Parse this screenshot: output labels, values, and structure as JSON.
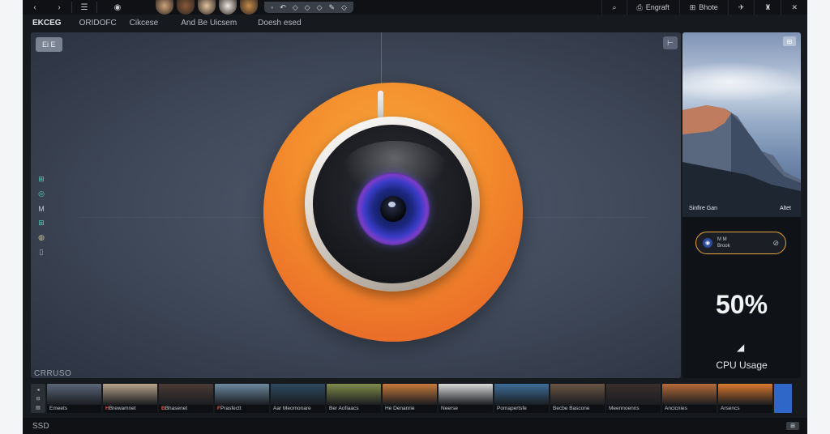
{
  "topbar": {
    "nav": {
      "back": "‹",
      "forward": "›",
      "menu": "☰",
      "record": "◉"
    },
    "tools": [
      "◦",
      "↶",
      "◇",
      "◇",
      "◇",
      "✎",
      "◇"
    ],
    "right": [
      {
        "icon": "⌕",
        "label": ""
      },
      {
        "icon": "⎙",
        "label": "Engraft"
      },
      {
        "icon": "⊞",
        "label": "Bhote"
      },
      {
        "icon": "✈",
        "label": ""
      },
      {
        "icon": "♜",
        "label": ""
      },
      {
        "icon": "✕",
        "label": ""
      }
    ],
    "avatar_colors": [
      "#cfa27a",
      "#8b5a3a",
      "#e3c2a0",
      "#efe7e0",
      "#c48a4a"
    ]
  },
  "menubar": [
    "EKCEG",
    "ORIDOFC",
    "Cikcese",
    "And Be Uicsem",
    "Doesh esed"
  ],
  "canvas": {
    "chip_label": "Ei E",
    "corner_icon": "⊢",
    "left_icons": [
      "⊞",
      "◎",
      "M",
      "⊞",
      "◍",
      "▯"
    ],
    "caption": "CRRUSO"
  },
  "right_panel": {
    "photo_btn": "⊞",
    "photo_caption": "Sinfire Gan",
    "photo_tag": "Altet",
    "pill": {
      "icon": "◉",
      "line1": "M M",
      "line2": "Brook",
      "end": "⊘"
    },
    "value": "50%",
    "arrow": "◢",
    "label": "CPU Usage"
  },
  "filmstrip": {
    "side_icons": [
      "◂",
      "⊟",
      "▤"
    ],
    "frames": [
      {
        "label": "Emeets",
        "accent": "",
        "color": "#5b6678"
      },
      {
        "label": "Brewamnet",
        "accent": "H",
        "color": "#b8a48c"
      },
      {
        "label": "Bhasenet",
        "accent": "B",
        "color": "#4a3a36"
      },
      {
        "label": "Prasfectt",
        "accent": "F",
        "color": "#6d8aa0"
      },
      {
        "label": "Aar Meomonare",
        "accent": "",
        "color": "#2d4a5e"
      },
      {
        "label": "Ber Aofiaacs",
        "accent": "",
        "color": "#7f8c4a"
      },
      {
        "label": "He Denanrie",
        "accent": "",
        "color": "#c77a3a"
      },
      {
        "label": "Neerse",
        "accent": "",
        "color": "#d8d8d8"
      },
      {
        "label": "Pomapertsfe",
        "accent": "",
        "color": "#3e6e9a"
      },
      {
        "label": "Becbe Bascone",
        "accent": "",
        "color": "#6a5544"
      },
      {
        "label": "Meennoenns",
        "accent": "",
        "color": "#3a2f2c"
      },
      {
        "label": "Ancicnies",
        "accent": "",
        "color": "#b86a3a"
      },
      {
        "label": "Arsencs",
        "accent": "",
        "color": "#d9792e"
      }
    ]
  },
  "bottombar": {
    "label": "SSD",
    "right_icon": "⊞"
  }
}
